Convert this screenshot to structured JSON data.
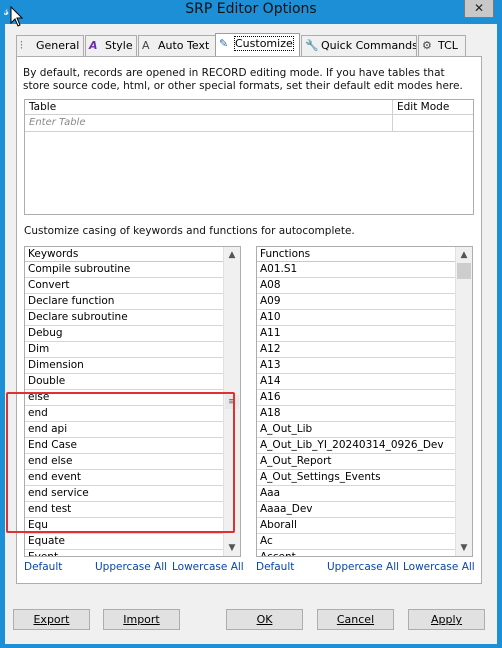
{
  "window": {
    "title": "SRP Editor Options",
    "close_glyph": "✕"
  },
  "tabs": [
    {
      "label": "General",
      "icon": "sliders-icon"
    },
    {
      "label": "Style",
      "icon": "font-style-icon"
    },
    {
      "label": "Auto Text",
      "icon": "auto-text-icon"
    },
    {
      "label": "Customize",
      "icon": "customize-icon"
    },
    {
      "label": "Quick Commands",
      "icon": "wrench-icon"
    },
    {
      "label": "TCL",
      "icon": "gear-icon"
    }
  ],
  "active_tab": "Customize",
  "info_text": "By default, records are opened in RECORD editing mode. If you have tables that store source code, html, or other special formats, set their default edit modes here.",
  "table": {
    "columns": [
      "Table",
      "Edit Mode"
    ],
    "placeholder": "Enter Table"
  },
  "casing_text": "Customize casing of keywords and functions for autocomplete.",
  "keywords": {
    "header": "Keywords",
    "items": [
      "Compile subroutine",
      "Convert",
      "Declare function",
      "Declare subroutine",
      "Debug",
      "Dim",
      "Dimension",
      "Double",
      "else",
      "end",
      "end api",
      "End Case",
      "end else",
      "end event",
      "end service",
      "end test",
      "Equ",
      "Equate",
      "Event"
    ]
  },
  "functions": {
    "header": "Functions",
    "items": [
      "A01.S1",
      "A08",
      "A09",
      "A10",
      "A11",
      "A12",
      "A13",
      "A14",
      "A16",
      "A18",
      "A_Out_Lib",
      "A_Out_Lib_YI_20240314_0926_Dev",
      "A_Out_Report",
      "A_Out_Settings_Events",
      "Aaa",
      "Aaaa_Dev",
      "Aborall",
      "Ac",
      "Accent"
    ]
  },
  "links": {
    "default": "Default",
    "uppercase": "Uppercase All",
    "lowercase": "Lowercase All"
  },
  "buttons": {
    "export": "Export",
    "import": "Import",
    "ok": "OK",
    "cancel": "Cancel",
    "apply": "Apply"
  },
  "colors": {
    "titlebar": "#1c8fd6",
    "highlight_box": "#e03030",
    "link": "#0645ad"
  }
}
